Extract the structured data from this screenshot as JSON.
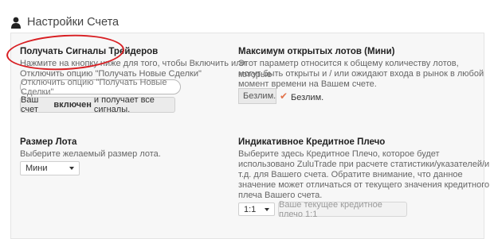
{
  "header": {
    "icon": "user-icon",
    "title": "Настройки Счета"
  },
  "signals": {
    "title": "Получать Сигналы Трейдеров",
    "desc_line1": "Нажмите на кнопку ниже для того, чтобы Включить или",
    "desc_line2": "Отключить опцию \"Получать Новые Сделки\"",
    "toggle_button": "Отключить опцию \"Получать Новые Сделки\"",
    "status_prefix": "Ваш счет",
    "status_bold": "включен",
    "status_suffix": "и получает все сигналы."
  },
  "max_lots": {
    "title": "Максимум открытых лотов (Мини)",
    "desc_line1": "Этот параметр относится к общему количеству лотов, которые",
    "desc_line2": "могут быть открыты и / или ожидают входа в рынок в любой",
    "desc_line3": "момент времени на Вашем счете.",
    "input_value": "Безлим.",
    "checkbox_label": "Безлим.",
    "checkbox_checked": true
  },
  "lot_size": {
    "title": "Размер Лота",
    "desc": "Выберите желаемый размер лота.",
    "select_value": "Мини"
  },
  "leverage": {
    "title": "Индикативное Кредитное Плечо",
    "desc_line1": "Выберите здесь Кредитное Плечо, которое будет",
    "desc_line2": "использовано ZuluTrade при расчете статистики/указателей/и",
    "desc_line3": "т.д. для Вашего счета. Обратите внимание, что данное",
    "desc_line4": "значение может отличаться от текущего значения кредитного",
    "desc_line5": "плеча Вашего счета.",
    "select_value": "1:1",
    "button": "Ваше текущее кредитное плечо 1:1"
  },
  "colors": {
    "accent": "#e2734b",
    "annotation": "#d81e22",
    "panel_bg": "#f7f7f7"
  }
}
